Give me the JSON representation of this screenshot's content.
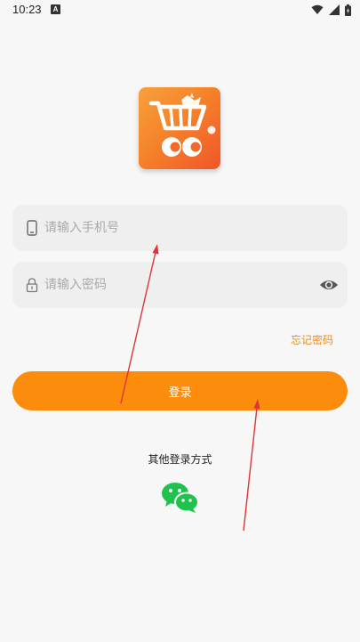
{
  "status_bar": {
    "time": "10:23",
    "notification_glyph": "A",
    "icons": [
      "wifi-icon",
      "signal-icon",
      "battery-icon"
    ]
  },
  "logo": {
    "icon": "shopping-cart-icon",
    "colors": [
      "#f7a03c",
      "#f0552a"
    ]
  },
  "login_form": {
    "phone": {
      "placeholder": "请输入手机号",
      "value": "",
      "icon": "phone-icon"
    },
    "password": {
      "placeholder": "请输入密码",
      "value": "",
      "icon": "lock-icon",
      "toggle_icon": "eye-icon"
    },
    "forgot_password": "忘记密码",
    "login_button": "登录"
  },
  "other_login": {
    "label": "其他登录方式",
    "methods": [
      "wechat-icon"
    ]
  },
  "colors": {
    "accent": "#fb8c0c",
    "link": "#f58a12",
    "field_bg": "#efefef",
    "page_bg": "#f7f7f7",
    "wechat": "#1fc24c",
    "annotation_arrow": "#e0333a"
  }
}
